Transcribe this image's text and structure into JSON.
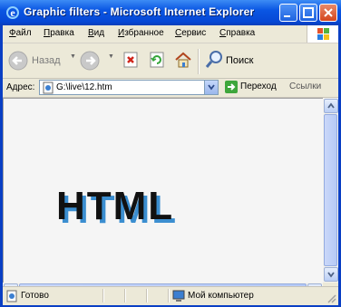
{
  "window": {
    "title": "Graphic filters - Microsoft Internet Explorer"
  },
  "menu": {
    "items": [
      {
        "label": "Файл",
        "u": "Ф",
        "rest": "айл"
      },
      {
        "label": "Правка",
        "u": "П",
        "rest": "равка"
      },
      {
        "label": "Вид",
        "u": "В",
        "rest": "ид"
      },
      {
        "label": "Избранное",
        "u": "И",
        "rest": "збранное"
      },
      {
        "label": "Сервис",
        "u": "С",
        "rest": "ервис"
      },
      {
        "label": "Справка",
        "u": "С",
        "rest": "правка"
      }
    ]
  },
  "toolbar": {
    "back_label": "Назад",
    "search_label": "Поиск"
  },
  "address": {
    "label": "Адрес:",
    "url": "G:\\live\\12.htm",
    "go_label": "Переход",
    "links_label": "Ссылки"
  },
  "content": {
    "heading_text": "HTML",
    "text_color": "#111111",
    "shadow_color": "#3b8ed0"
  },
  "status": {
    "text": "Готово",
    "zone": "Мой компьютер"
  }
}
